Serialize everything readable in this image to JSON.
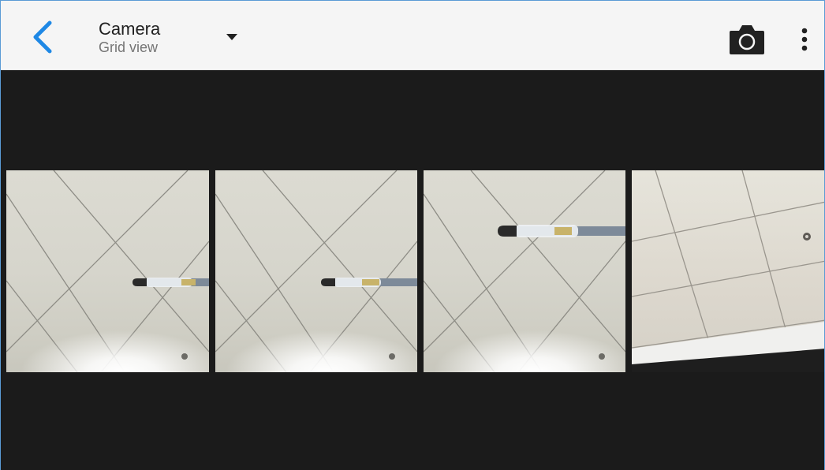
{
  "toolbar": {
    "title": "Camera",
    "subtitle": "Grid view",
    "back_icon": "chevron-left-icon",
    "dropdown_icon": "caret-down-icon",
    "camera_icon": "camera-icon",
    "menu_icon": "more-vertical-icon",
    "accent_color": "#1e88e5"
  },
  "grid": {
    "photos": [
      {
        "subject": "pen against ceiling tiles"
      },
      {
        "subject": "pen against ceiling tiles"
      },
      {
        "subject": "pen against ceiling tiles"
      },
      {
        "subject": "ceiling at an angle"
      }
    ]
  },
  "colors": {
    "toolbar_bg": "#f5f5f5",
    "content_bg": "#1b1b1b",
    "window_border": "#5b9bd5"
  }
}
